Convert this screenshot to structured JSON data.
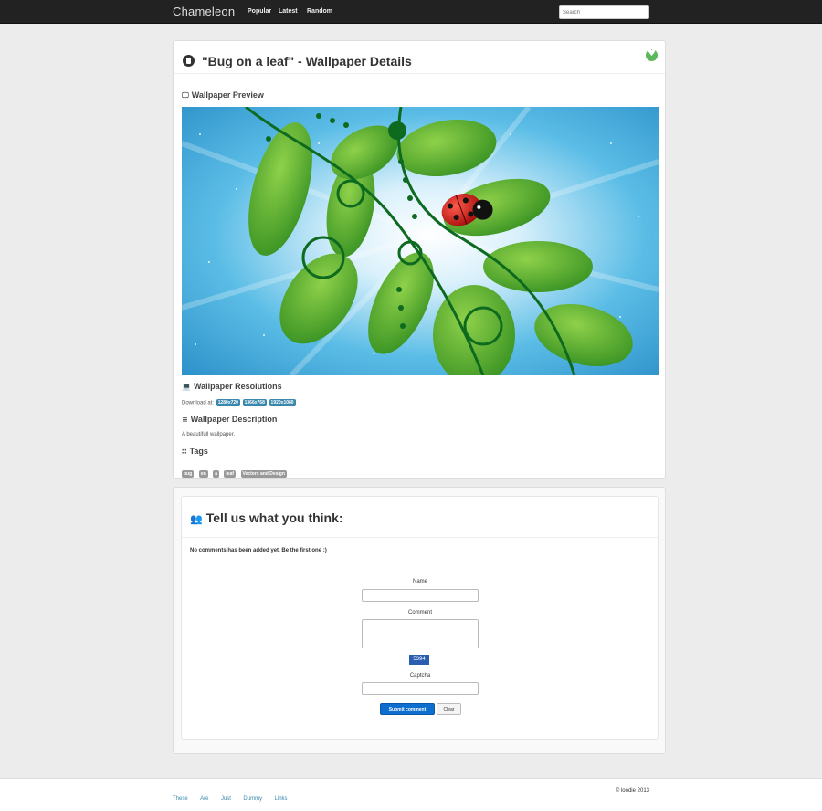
{
  "navbar": {
    "brand": "Chameleon",
    "links": [
      "Popular",
      "Latest",
      "Random"
    ],
    "search_placeholder": "Search"
  },
  "details": {
    "title": "\"Bug on a leaf\" - Wallpaper Details",
    "preview_heading": "Wallpaper Preview",
    "resolutions_heading": "Wallpaper Resolutions",
    "download_prefix": "Download at:",
    "resolutions": [
      "1280x720",
      "1366x768",
      "1920x1080"
    ],
    "description_heading": "Wallpaper Description",
    "description": "A beautifull wallpaper.",
    "tags_heading": "Tags",
    "tags": [
      "bug",
      "on",
      "a",
      "leaf",
      "Vectors and Design"
    ]
  },
  "comments": {
    "heading": "Tell us what you think:",
    "empty_message": "No comments has been added yet. Be the first one :)",
    "name_label": "Name",
    "comment_label": "Comment",
    "captcha_code": "5394",
    "captcha_label": "Captcha",
    "submit_label": "Submit comment",
    "clear_label": "Clear"
  },
  "footer": {
    "links": [
      "These",
      "Are",
      "Just",
      "Dummy",
      "Links"
    ],
    "copyright": "© loodie 2013"
  },
  "colors": {
    "navbar": "#222222",
    "label_info": "#3a87ad",
    "label_default": "#999999",
    "like_green": "#5cb85c",
    "submit_blue": "#0d6ecf"
  },
  "icons": {
    "title": "file-icon",
    "like": "heart-icon",
    "preview": "monitor-icon",
    "resolutions": "laptop-icon",
    "description": "list-icon",
    "tags": "grid-icon",
    "comments": "users-icon"
  }
}
